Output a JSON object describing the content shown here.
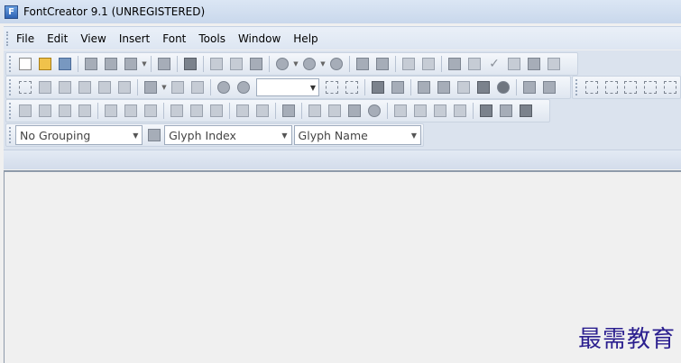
{
  "window": {
    "title": "FontCreator 9.1 (UNREGISTERED)",
    "icon": "fontcreator-app-icon",
    "icon_letter": "F"
  },
  "menu": [
    {
      "label": "File"
    },
    {
      "label": "Edit"
    },
    {
      "label": "View"
    },
    {
      "label": "Insert"
    },
    {
      "label": "Font"
    },
    {
      "label": "Tools"
    },
    {
      "label": "Window"
    },
    {
      "label": "Help"
    }
  ],
  "toolbar": {
    "grouping_combo": {
      "value": "No Grouping"
    },
    "index_combo": {
      "value": "Glyph Index"
    },
    "name_combo": {
      "value": "Glyph Name"
    },
    "zoom_value": ""
  },
  "watermark": {
    "text": "最需教育"
  },
  "colors": {
    "menubar": "#dde6f2",
    "workspace": "#f0f0f0",
    "watermark": "#2b1f8f"
  }
}
